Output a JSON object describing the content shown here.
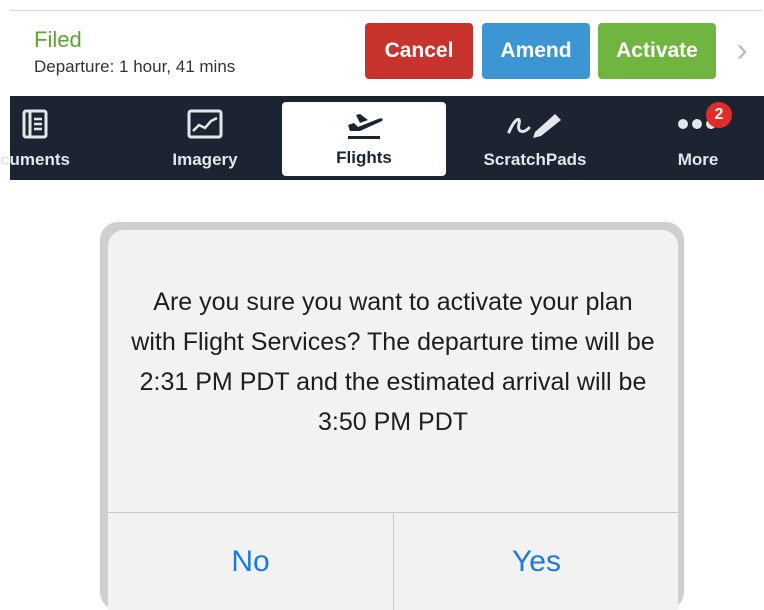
{
  "status": {
    "label": "Filed",
    "departure": "Departure: 1 hour, 41 mins",
    "colors": {
      "filed": "#5ba432"
    }
  },
  "actions": {
    "cancel": "Cancel",
    "amend": "Amend",
    "activate": "Activate",
    "colors": {
      "cancel": "#c8332d",
      "amend": "#3d96d4",
      "activate": "#6fb53f"
    }
  },
  "tabs": [
    {
      "label": "cuments",
      "icon": "documents-icon"
    },
    {
      "label": "Imagery",
      "icon": "imagery-icon"
    },
    {
      "label": "Flights",
      "icon": "airplane-departure-icon",
      "selected": true
    },
    {
      "label": "ScratchPads",
      "icon": "scratchpad-pen-icon"
    },
    {
      "label": "More",
      "icon": "more-dots-icon",
      "badge": "2"
    }
  ],
  "alert": {
    "message": "Are you sure you want to activate your plan with Flight Services? The departure time will be 2:31 PM PDT and the estimated arrival will be 3:50 PM PDT",
    "no": "No",
    "yes": "Yes"
  }
}
